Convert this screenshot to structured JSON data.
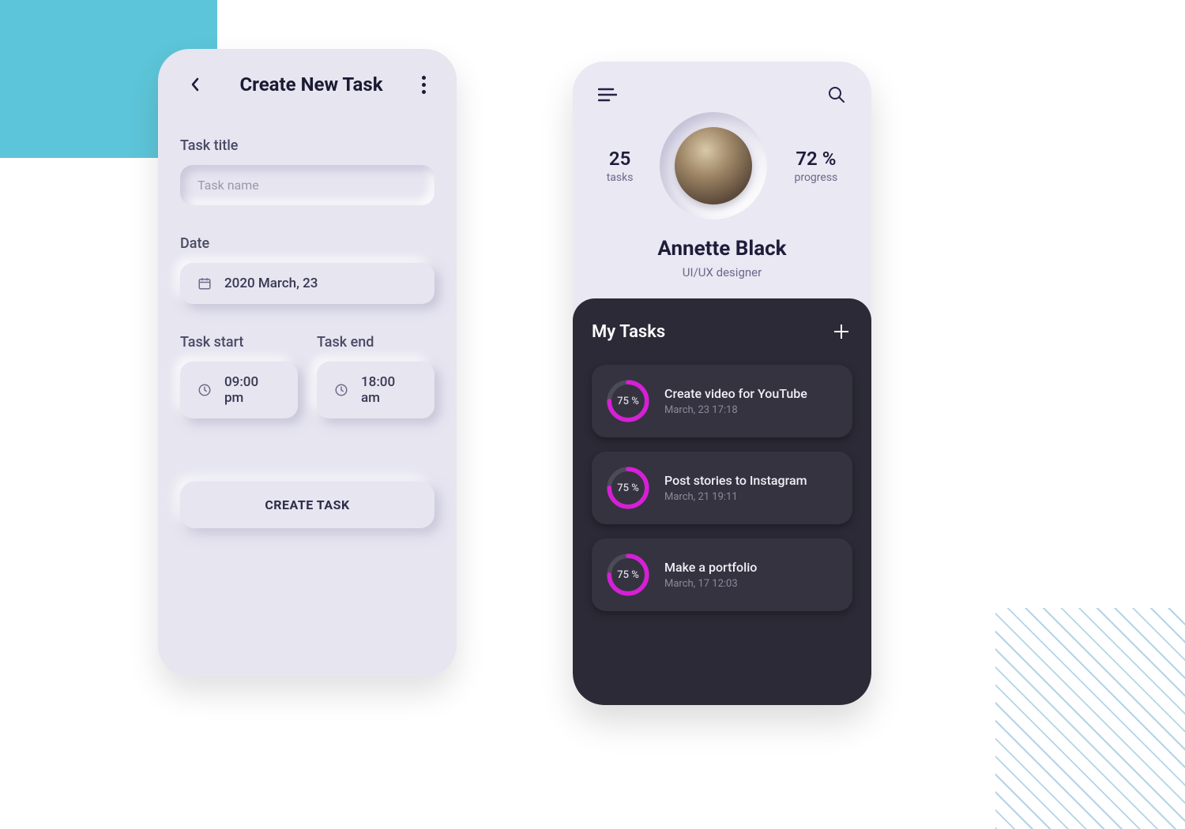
{
  "phone1": {
    "header_title": "Create New Task",
    "task_title_label": "Task title",
    "task_title_placeholder": "Task name",
    "date_label": "Date",
    "date_value": "2020 March, 23",
    "task_start_label": "Task start",
    "task_start_value": "09:00 pm",
    "task_end_label": "Task end",
    "task_end_value": "18:00 am",
    "create_button": "CREATE TASK"
  },
  "phone2": {
    "stat1_num": "25",
    "stat1_lbl": "tasks",
    "stat2_num": "72 %",
    "stat2_lbl": "progress",
    "name": "Annette Black",
    "role": "UI/UX designer",
    "tasks_title": "My Tasks",
    "tasks": [
      {
        "pct": "75 %",
        "title": "Create video for YouTube",
        "date": "March, 23 17:18"
      },
      {
        "pct": "75 %",
        "title": "Post stories to Instagram",
        "date": "March, 21 19:11"
      },
      {
        "pct": "75 %",
        "title": "Make a portfolio",
        "date": "March, 17 12:03"
      }
    ]
  }
}
